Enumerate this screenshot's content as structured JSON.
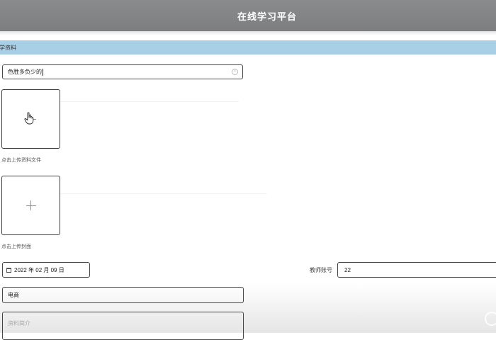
{
  "header": {
    "title": "在线学习平台"
  },
  "section": {
    "label": "学资料"
  },
  "form": {
    "title_value": "色胜多负少的",
    "file_upload_hint": "点击上传资料文件",
    "cover_upload_hint": "点击上传封面",
    "date_value": "2022 年 02 月 09 日",
    "teacher_label": "教师账号",
    "teacher_value": "22",
    "category_value": "电商",
    "intro_placeholder": "资料简介"
  }
}
